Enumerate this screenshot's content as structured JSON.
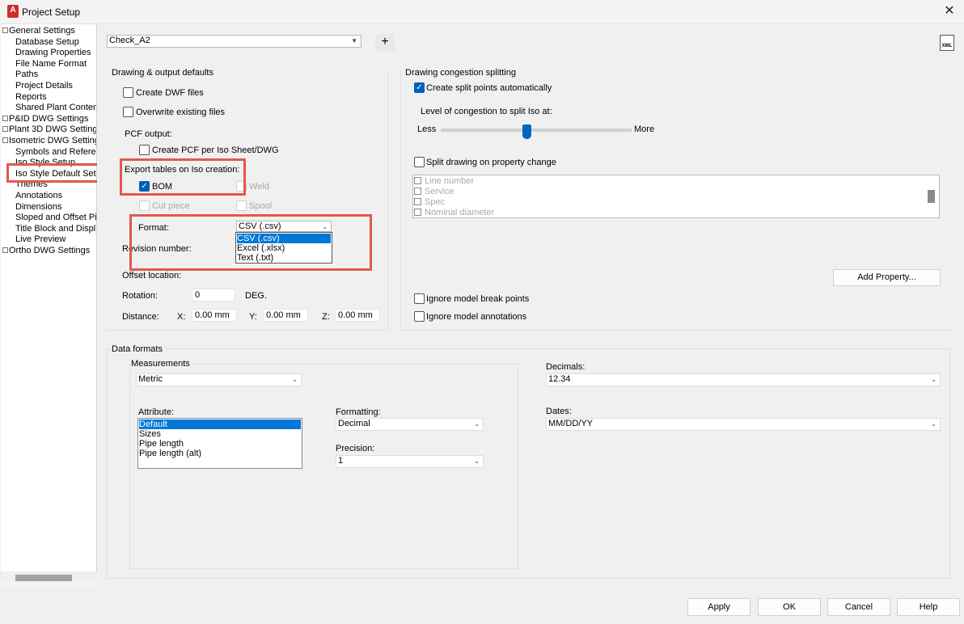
{
  "window": {
    "title": "Project Setup",
    "app_badge": "A",
    "close": "✕"
  },
  "tree": [
    {
      "label": "General Settings",
      "toggle": true
    },
    {
      "label": "Database Setup"
    },
    {
      "label": "Drawing Properties"
    },
    {
      "label": "File Name Format"
    },
    {
      "label": "Paths"
    },
    {
      "label": "Project Details"
    },
    {
      "label": "Reports"
    },
    {
      "label": "Shared Plant Conten"
    },
    {
      "label": "P&ID DWG Settings",
      "toggle": true
    },
    {
      "label": "Plant 3D DWG Setting",
      "toggle": true
    },
    {
      "label": "Isometric DWG Setting",
      "toggle": true
    },
    {
      "label": "Symbols and Referer"
    },
    {
      "label": "Iso Style Setup"
    },
    {
      "label": "Iso Style Default Set"
    },
    {
      "label": "Themes"
    },
    {
      "label": "Annotations"
    },
    {
      "label": "Dimensions"
    },
    {
      "label": "Sloped and Offset Pi"
    },
    {
      "label": "Title Block and Displ"
    },
    {
      "label": "Live Preview"
    },
    {
      "label": "Ortho DWG Settings",
      "toggle": true
    }
  ],
  "style_combo": {
    "value": "Check_A2",
    "add": "+"
  },
  "xml_icon": "XML",
  "output": {
    "heading": "Drawing & output defaults",
    "create_dwf": "Create DWF files",
    "overwrite": "Overwrite existing files",
    "pcf_output": "PCF output:",
    "create_pcf": "Create PCF per Iso Sheet/DWG",
    "export_tables": "Export tables on Iso creation:",
    "bom": "BOM",
    "weld": "Weld",
    "cut_piece": "Cut piece",
    "spool": "Spool",
    "format_label": "Format:",
    "format_value": "CSV (.csv)",
    "format_options": [
      "CSV (.csv)",
      "Excel (.xlsx)",
      "Text (.txt)"
    ],
    "revision_label": "Revision number:",
    "offset_label": "Offset location:",
    "rotation_label": "Rotation:",
    "rotation_value": "0",
    "deg": "DEG.",
    "distance_label": "Distance:",
    "x_label": "X:",
    "x_value": "0.00 mm",
    "y_label": "Y:",
    "y_value": "0.00 mm",
    "z_label": "Z:",
    "z_value": "0.00 mm"
  },
  "congestion": {
    "heading": "Drawing congestion splitting",
    "create_split": "Create split points automatically",
    "level_label": "Level of congestion to split Iso at:",
    "less": "Less",
    "more": "More",
    "slider_level": 0.45,
    "split_property": "Split drawing on property change",
    "properties": [
      "Line number",
      "Service",
      "Spec",
      "Nominal diameter"
    ],
    "add_property": "Add Property...",
    "ignore_break": "Ignore model break points",
    "ignore_annot": "Ignore model annotations"
  },
  "data_formats": {
    "heading": "Data formats",
    "measurements": "Measurements",
    "units": "Metric",
    "attribute_label": "Attribute:",
    "attributes": [
      "Default",
      "Sizes",
      "Pipe length",
      "Pipe length (alt)"
    ],
    "formatting_label": "Formatting:",
    "formatting_value": "Decimal",
    "precision_label": "Precision:",
    "precision_value": "1",
    "decimals_label": "Decimals:",
    "decimals_value": "12.34",
    "dates_label": "Dates:",
    "dates_value": "MM/DD/YY"
  },
  "buttons": {
    "apply": "Apply",
    "ok": "OK",
    "cancel": "Cancel",
    "help": "Help"
  },
  "colors": {
    "highlight": "#e0594e",
    "accent": "#005fb8",
    "selection": "#0078d7"
  }
}
